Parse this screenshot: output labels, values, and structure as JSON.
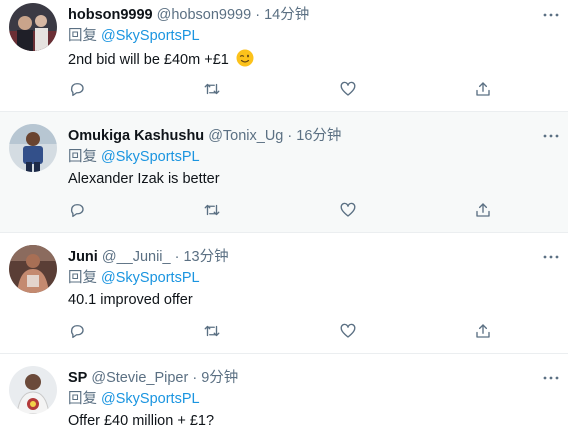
{
  "colors": {
    "link": "#1b95e0",
    "muted": "#5b7083",
    "text": "#0f1419",
    "highlight_bg": "#f7f9f9",
    "divider": "#ebeef0"
  },
  "tweets": [
    {
      "name": "hobson9999",
      "handle": "@hobson9999",
      "sep": "·",
      "time": "14分钟",
      "reply_prefix": "回复 ",
      "reply_to": "@SkySportsPL",
      "text": "2nd bid will be £40m +£1",
      "emoji": "winking-face"
    },
    {
      "name": "Omukiga Kashushu",
      "handle": "@Tonix_Ug",
      "sep": "·",
      "time": "16分钟",
      "reply_prefix": "回复 ",
      "reply_to": "@SkySportsPL",
      "text": "Alexander Izak is better"
    },
    {
      "name": "Juni",
      "handle": "@__Junii_",
      "sep": "·",
      "time": "13分钟",
      "reply_prefix": "回复 ",
      "reply_to": "@SkySportsPL",
      "text": "40.1 improved offer"
    },
    {
      "name": "SP",
      "handle": "@Stevie_Piper",
      "sep": "·",
      "time": "9分钟",
      "reply_prefix": "回复 ",
      "reply_to": "@SkySportsPL",
      "text": "Offer £40 million + £1?"
    }
  ],
  "icons": {
    "more": "more-dots-icon",
    "reply": "reply-icon",
    "retweet": "retweet-icon",
    "like": "heart-icon",
    "share": "share-icon"
  }
}
